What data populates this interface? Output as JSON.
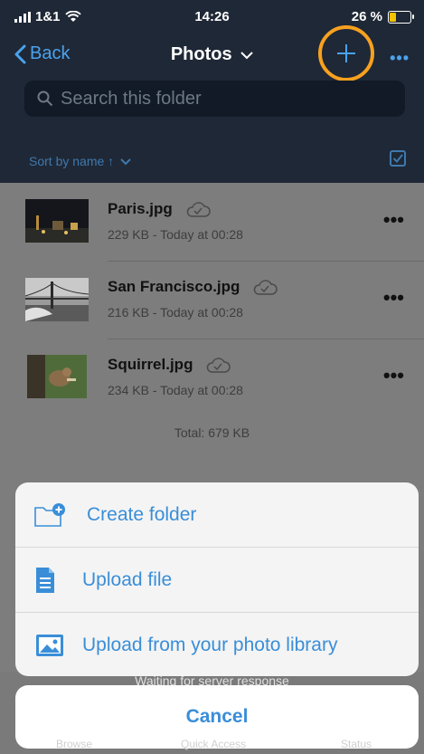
{
  "status_bar": {
    "carrier": "1&1",
    "time": "14:26",
    "battery": "26 %"
  },
  "nav": {
    "back_label": "Back",
    "title": "Photos",
    "more_label": "•••"
  },
  "search": {
    "placeholder": "Search this folder"
  },
  "sort": {
    "label": "Sort by name ↑"
  },
  "files": [
    {
      "name": "Paris.jpg",
      "meta": "229 KB - Today at 00:28"
    },
    {
      "name": "San Francisco.jpg",
      "meta": "216 KB - Today at 00:28"
    },
    {
      "name": "Squirrel.jpg",
      "meta": "234 KB - Today at 00:28"
    }
  ],
  "total": "Total: 679 KB",
  "action_sheet": {
    "create_folder": "Create folder",
    "upload_file": "Upload file",
    "upload_photo": "Upload from your photo library"
  },
  "waiting_text": "Waiting for server response",
  "cancel_label": "Cancel",
  "tabs": {
    "browse": "Browse",
    "quick_access": "Quick Access",
    "status": "Status"
  },
  "colors": {
    "accent": "#3a8ed8",
    "highlight": "#f7a11f",
    "header_bg": "#1f2836"
  }
}
